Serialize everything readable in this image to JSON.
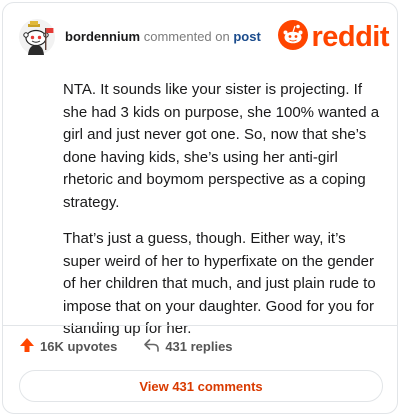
{
  "header": {
    "username": "bordennium",
    "verb": "commented on",
    "post_link": "post",
    "brand": "reddit"
  },
  "comment": {
    "paragraphs": [
      "NTA. It sounds like your sister is projecting. If she had 3 kids on purpose, she 100% wanted a girl and just never got one. So, now that she’s done having kids, she’s using her anti-girl rhetoric and boymom perspective as a coping strategy.",
      "That’s just a guess, though. Either way, it’s super weird of her to hyperfixate on the gender of her children that much, and just plain rude to impose that on your daughter. Good for you for standing up for her."
    ]
  },
  "actions": {
    "upvotes_label": "16K upvotes",
    "replies_label": "431 replies"
  },
  "footer": {
    "view_comments_label": "View 431 comments"
  },
  "colors": {
    "brand": "#ff4500",
    "link": "#1a4b8c",
    "button_text": "#d93a00",
    "border": "#e2e5e8"
  },
  "icons": {
    "avatar": "snoo-avatar",
    "upvote": "upvote-arrow-icon",
    "reply": "reply-arrow-icon",
    "logo": "reddit-snoo-logo-icon"
  }
}
